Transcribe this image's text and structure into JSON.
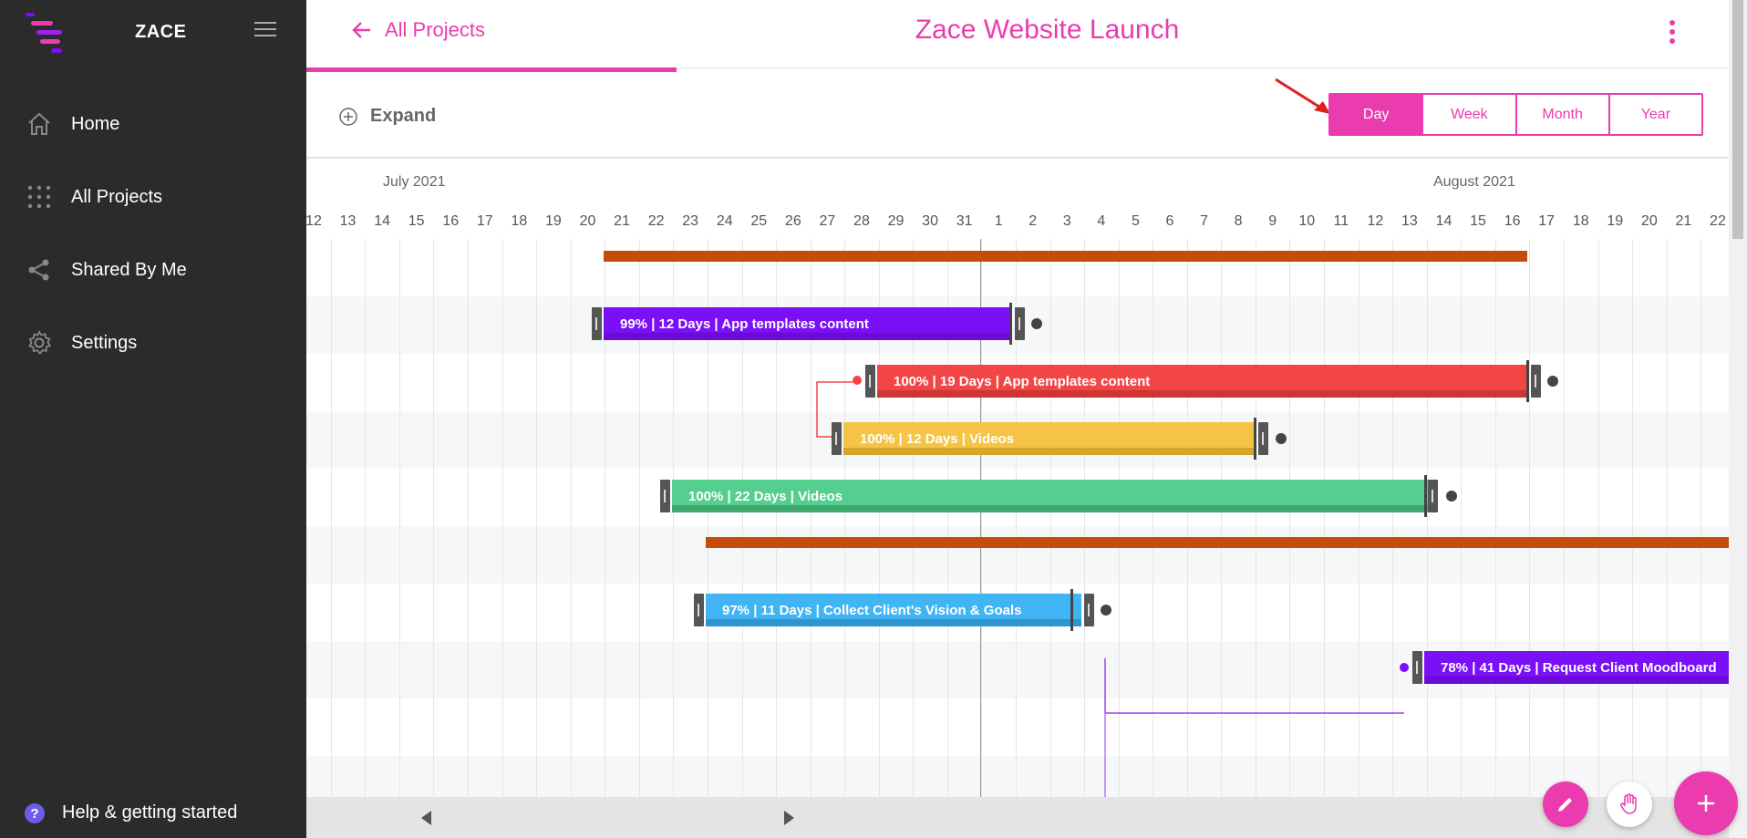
{
  "app": {
    "brand": "ZACE"
  },
  "sidebar": {
    "items": [
      {
        "label": "Home",
        "icon": "home-icon"
      },
      {
        "label": "All Projects",
        "icon": "grid-icon"
      },
      {
        "label": "Shared By Me",
        "icon": "share-icon"
      },
      {
        "label": "Settings",
        "icon": "gear-icon"
      }
    ],
    "help": {
      "label": "Help & getting started",
      "icon_glyph": "?"
    }
  },
  "header": {
    "back_label": "All Projects",
    "title": "Zace Website Launch"
  },
  "toolbar": {
    "expand_label": "Expand",
    "views": [
      "Day",
      "Week",
      "Month",
      "Year"
    ],
    "active_view": "Day"
  },
  "timeline": {
    "months": [
      {
        "label": "July 2021"
      },
      {
        "label": "August 2021"
      }
    ],
    "days": [
      "12",
      "13",
      "14",
      "15",
      "16",
      "17",
      "18",
      "19",
      "20",
      "21",
      "22",
      "23",
      "24",
      "25",
      "26",
      "27",
      "28",
      "29",
      "30",
      "31",
      "1",
      "2",
      "3",
      "4",
      "5",
      "6",
      "7",
      "8",
      "9",
      "10",
      "11",
      "12",
      "13",
      "14",
      "15",
      "16",
      "17",
      "18",
      "19",
      "20",
      "21",
      "22"
    ],
    "tasks": [
      {
        "type": "summary",
        "color": "#c44d09"
      },
      {
        "type": "task",
        "label": "99% | 12 Days | App templates content",
        "color": "#7b0ff6",
        "shade": "#6a0bd6",
        "percent": 99,
        "days": 12
      },
      {
        "type": "task",
        "label": "100% | 19 Days | App templates content",
        "color": "#f24646",
        "shade": "#cf3535",
        "percent": 100,
        "days": 19
      },
      {
        "type": "task",
        "label": "100% | 12 Days | Videos",
        "color": "#f6c444",
        "shade": "#d6a52c",
        "percent": 100,
        "days": 12
      },
      {
        "type": "task",
        "label": "100% | 22 Days | Videos",
        "color": "#55cf8f",
        "shade": "#3eaa70",
        "percent": 100,
        "days": 22
      },
      {
        "type": "summary",
        "color": "#c44d09"
      },
      {
        "type": "task",
        "label": "97% | 11 Days | Collect Client's Vision & Goals",
        "color": "#41b4f3",
        "shade": "#2e95cf",
        "percent": 97,
        "days": 11
      },
      {
        "type": "task",
        "label": "78% | 41 Days | Request Client Moodboard",
        "color": "#7b0ff6",
        "shade": "#6a0bd6",
        "percent": 78,
        "days": 41
      }
    ]
  },
  "colors": {
    "accent": "#ea3cae",
    "sidebar_bg": "#2b2b2b",
    "summary": "#c44d09"
  }
}
